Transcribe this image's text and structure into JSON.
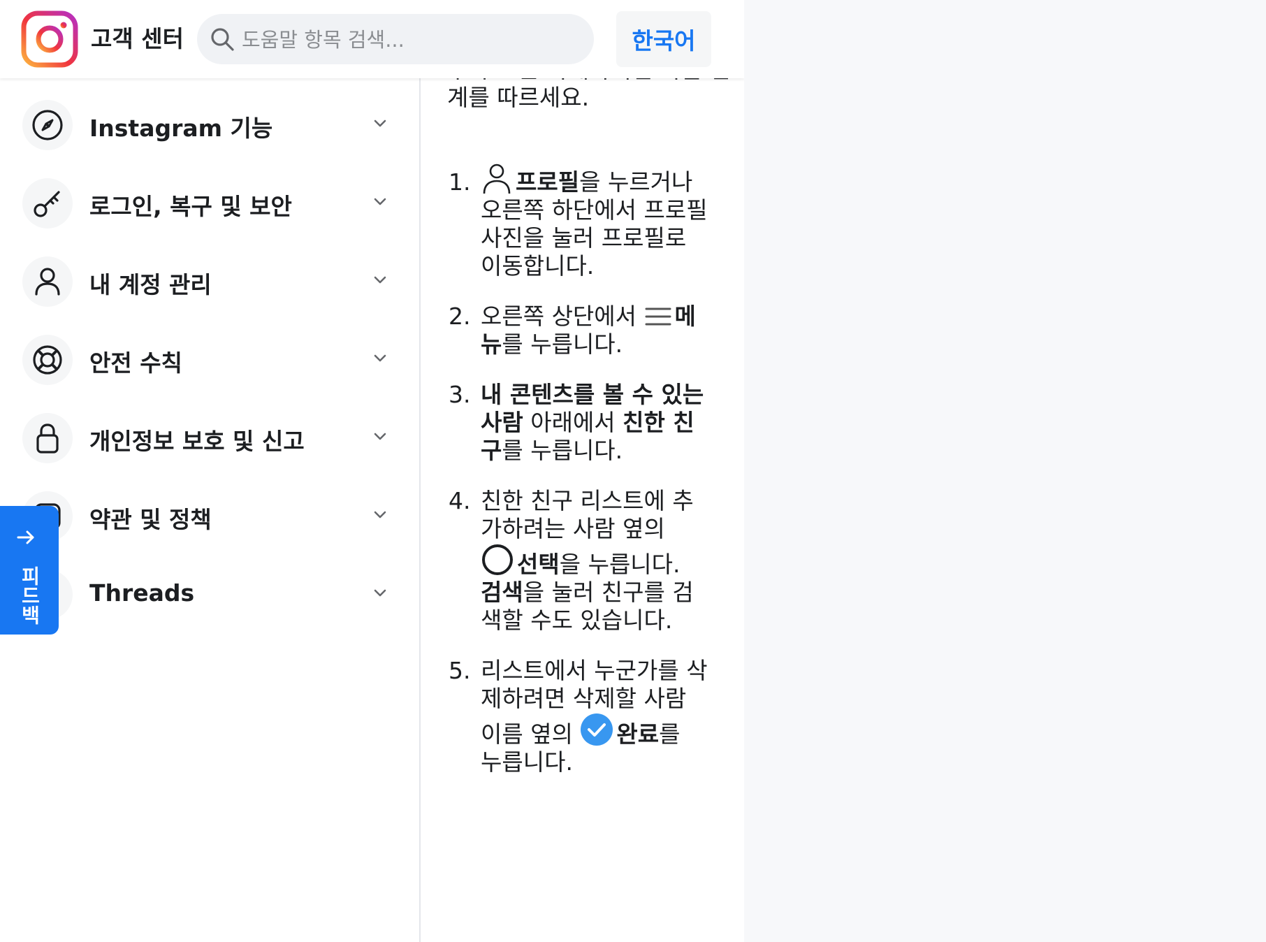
{
  "header": {
    "brand_title": "고객 센터",
    "search_placeholder": "도움말 항목 검색...",
    "language_label": "한국어"
  },
  "sidebar": {
    "items": [
      {
        "label": "Instagram 기능",
        "icon": "compass-icon"
      },
      {
        "label": "로그인, 복구 및 보안",
        "icon": "key-icon"
      },
      {
        "label": "내 계정 관리",
        "icon": "person-icon"
      },
      {
        "label": "안전 수칙",
        "icon": "lifebuoy-icon"
      },
      {
        "label": "개인정보 보호 및 신고",
        "icon": "lock-icon"
      },
      {
        "label": "약관 및 정책",
        "icon": "info-icon"
      },
      {
        "label": "Threads",
        "icon": "threads-icon"
      }
    ]
  },
  "feedback": {
    "label": "피드백"
  },
  "content": {
    "intro": "추가 또는 삭제하려면 다음 단계를 따르세요.",
    "steps": [
      {
        "bold": "프로필",
        "text": "을 누르거나 오른쪽 하단에서 프로필 사진을 눌러 프로필로 이동합니다."
      },
      {
        "text_before": "오른쪽 상단에서 ",
        "bold": "메뉴",
        "text": "를 누릅니다."
      },
      {
        "bold1": "내 콘텐츠를 볼 수 있는 사람",
        "text1": " 아래에서 ",
        "bold2": "친한 친구",
        "text2": "를 누릅니다."
      },
      {
        "text_before": "친한 친구 리스트에 추가하려는 사람 옆의 ",
        "bold1": "선택",
        "text1": "을 누릅니다. ",
        "bold2": "검색",
        "text2": "을 눌러 친구를 검색할 수도 있습니다."
      },
      {
        "text_before": "리스트에서 누군가를 삭제하려면 삭제할 사람 이름 옆의 ",
        "bold": "완료",
        "text": "를 누릅니다."
      }
    ]
  },
  "colors": {
    "accent": "#1877f2",
    "text": "#1c1e21",
    "placeholder": "#8a8d91",
    "search_bg": "#f0f2f5"
  }
}
